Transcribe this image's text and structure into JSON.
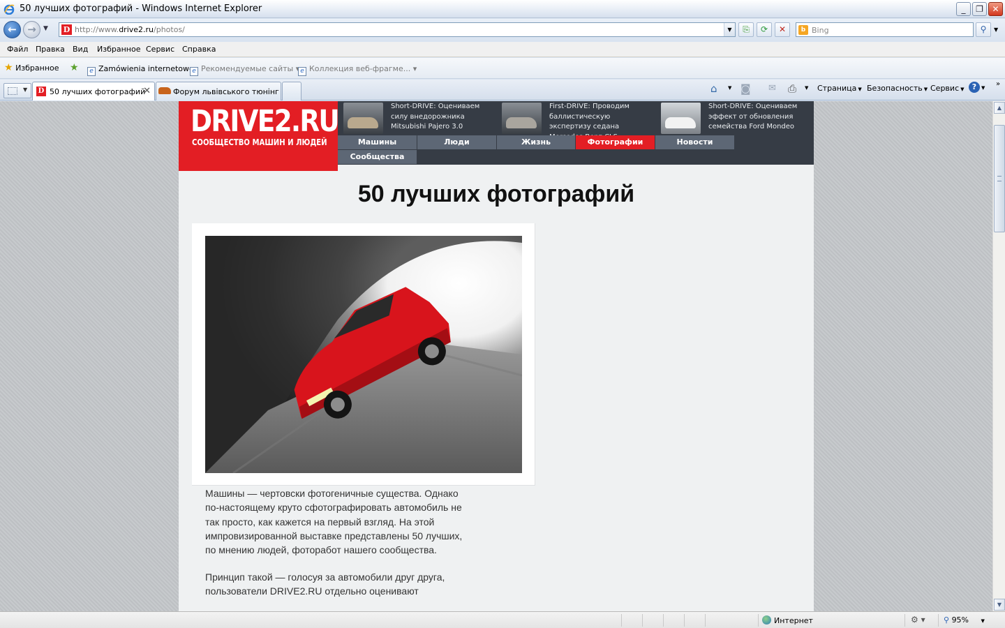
{
  "window": {
    "title": "50 лучших фотографий - Windows Internet Explorer",
    "controls": {
      "minimize": "_",
      "restore": "❐",
      "close": "✕"
    }
  },
  "addressbar": {
    "url_prefix": "http://www.",
    "url_host": "drive2.ru",
    "url_path": "/photos/",
    "search_placeholder": "Bing"
  },
  "menu": [
    "Файл",
    "Правка",
    "Вид",
    "Избранное",
    "Сервис",
    "Справка"
  ],
  "favorites": {
    "favorites_label": "Избранное",
    "links": [
      "Zamówienia internetowe",
      "Рекомендуемые сайты ▾",
      "Коллекция веб-фрагме... ▾"
    ]
  },
  "tabs": [
    {
      "label": "50 лучших фотографий",
      "active": true
    },
    {
      "label": "Форум львівського тюнінг ..."
    }
  ],
  "command_bar": {
    "page": "Страница",
    "safety": "Безопасность",
    "tools": "Сервис",
    "help": "?"
  },
  "site": {
    "logo_title": "DRIVE2.RU",
    "logo_tagline": "СООБЩЕСТВО МАШИН И ЛЮДЕЙ",
    "news": [
      {
        "text": "Short-DRIVE: Оцениваем силу внедорожника Mitsubishi Pajero 3.0",
        "thumb_color": "#b9a98e"
      },
      {
        "text": "First-DRIVE: Проводим баллистическую экспертизу седана Mercedes-Benz CLS",
        "thumb_color": "#a9a59e"
      },
      {
        "text": "Short-DRIVE: Оцениваем эффект от обновления семейства Ford Mondeo",
        "thumb_color": "#f2f2f2"
      }
    ],
    "nav": [
      "Машины",
      "Люди",
      "Жизнь",
      "Фотографии",
      "Новости",
      "Сообщества"
    ],
    "nav_active": "Фотографии",
    "page_title": "50 лучших фотографий",
    "article": [
      "Машины — чертовски фотогеничные существа. Однако по-настоящему круто сфотографировать автомобиль не так просто, как кажется на первый взгляд. На этой импровизированной выставке представлены 50 лучших, по мнению людей, фоторабот нашего сообщества.",
      "Принцип такой — голосуя за автомобили друг друга, пользователи DRIVE2.RU отдельно оценивают"
    ]
  },
  "statusbar": {
    "zone": "Интернет",
    "zoom": "95%"
  },
  "colors": {
    "brand_red": "#e31e24",
    "header_dark": "#363c45",
    "nav_grey": "#5d6775",
    "page_bg": "#eff1f2"
  }
}
